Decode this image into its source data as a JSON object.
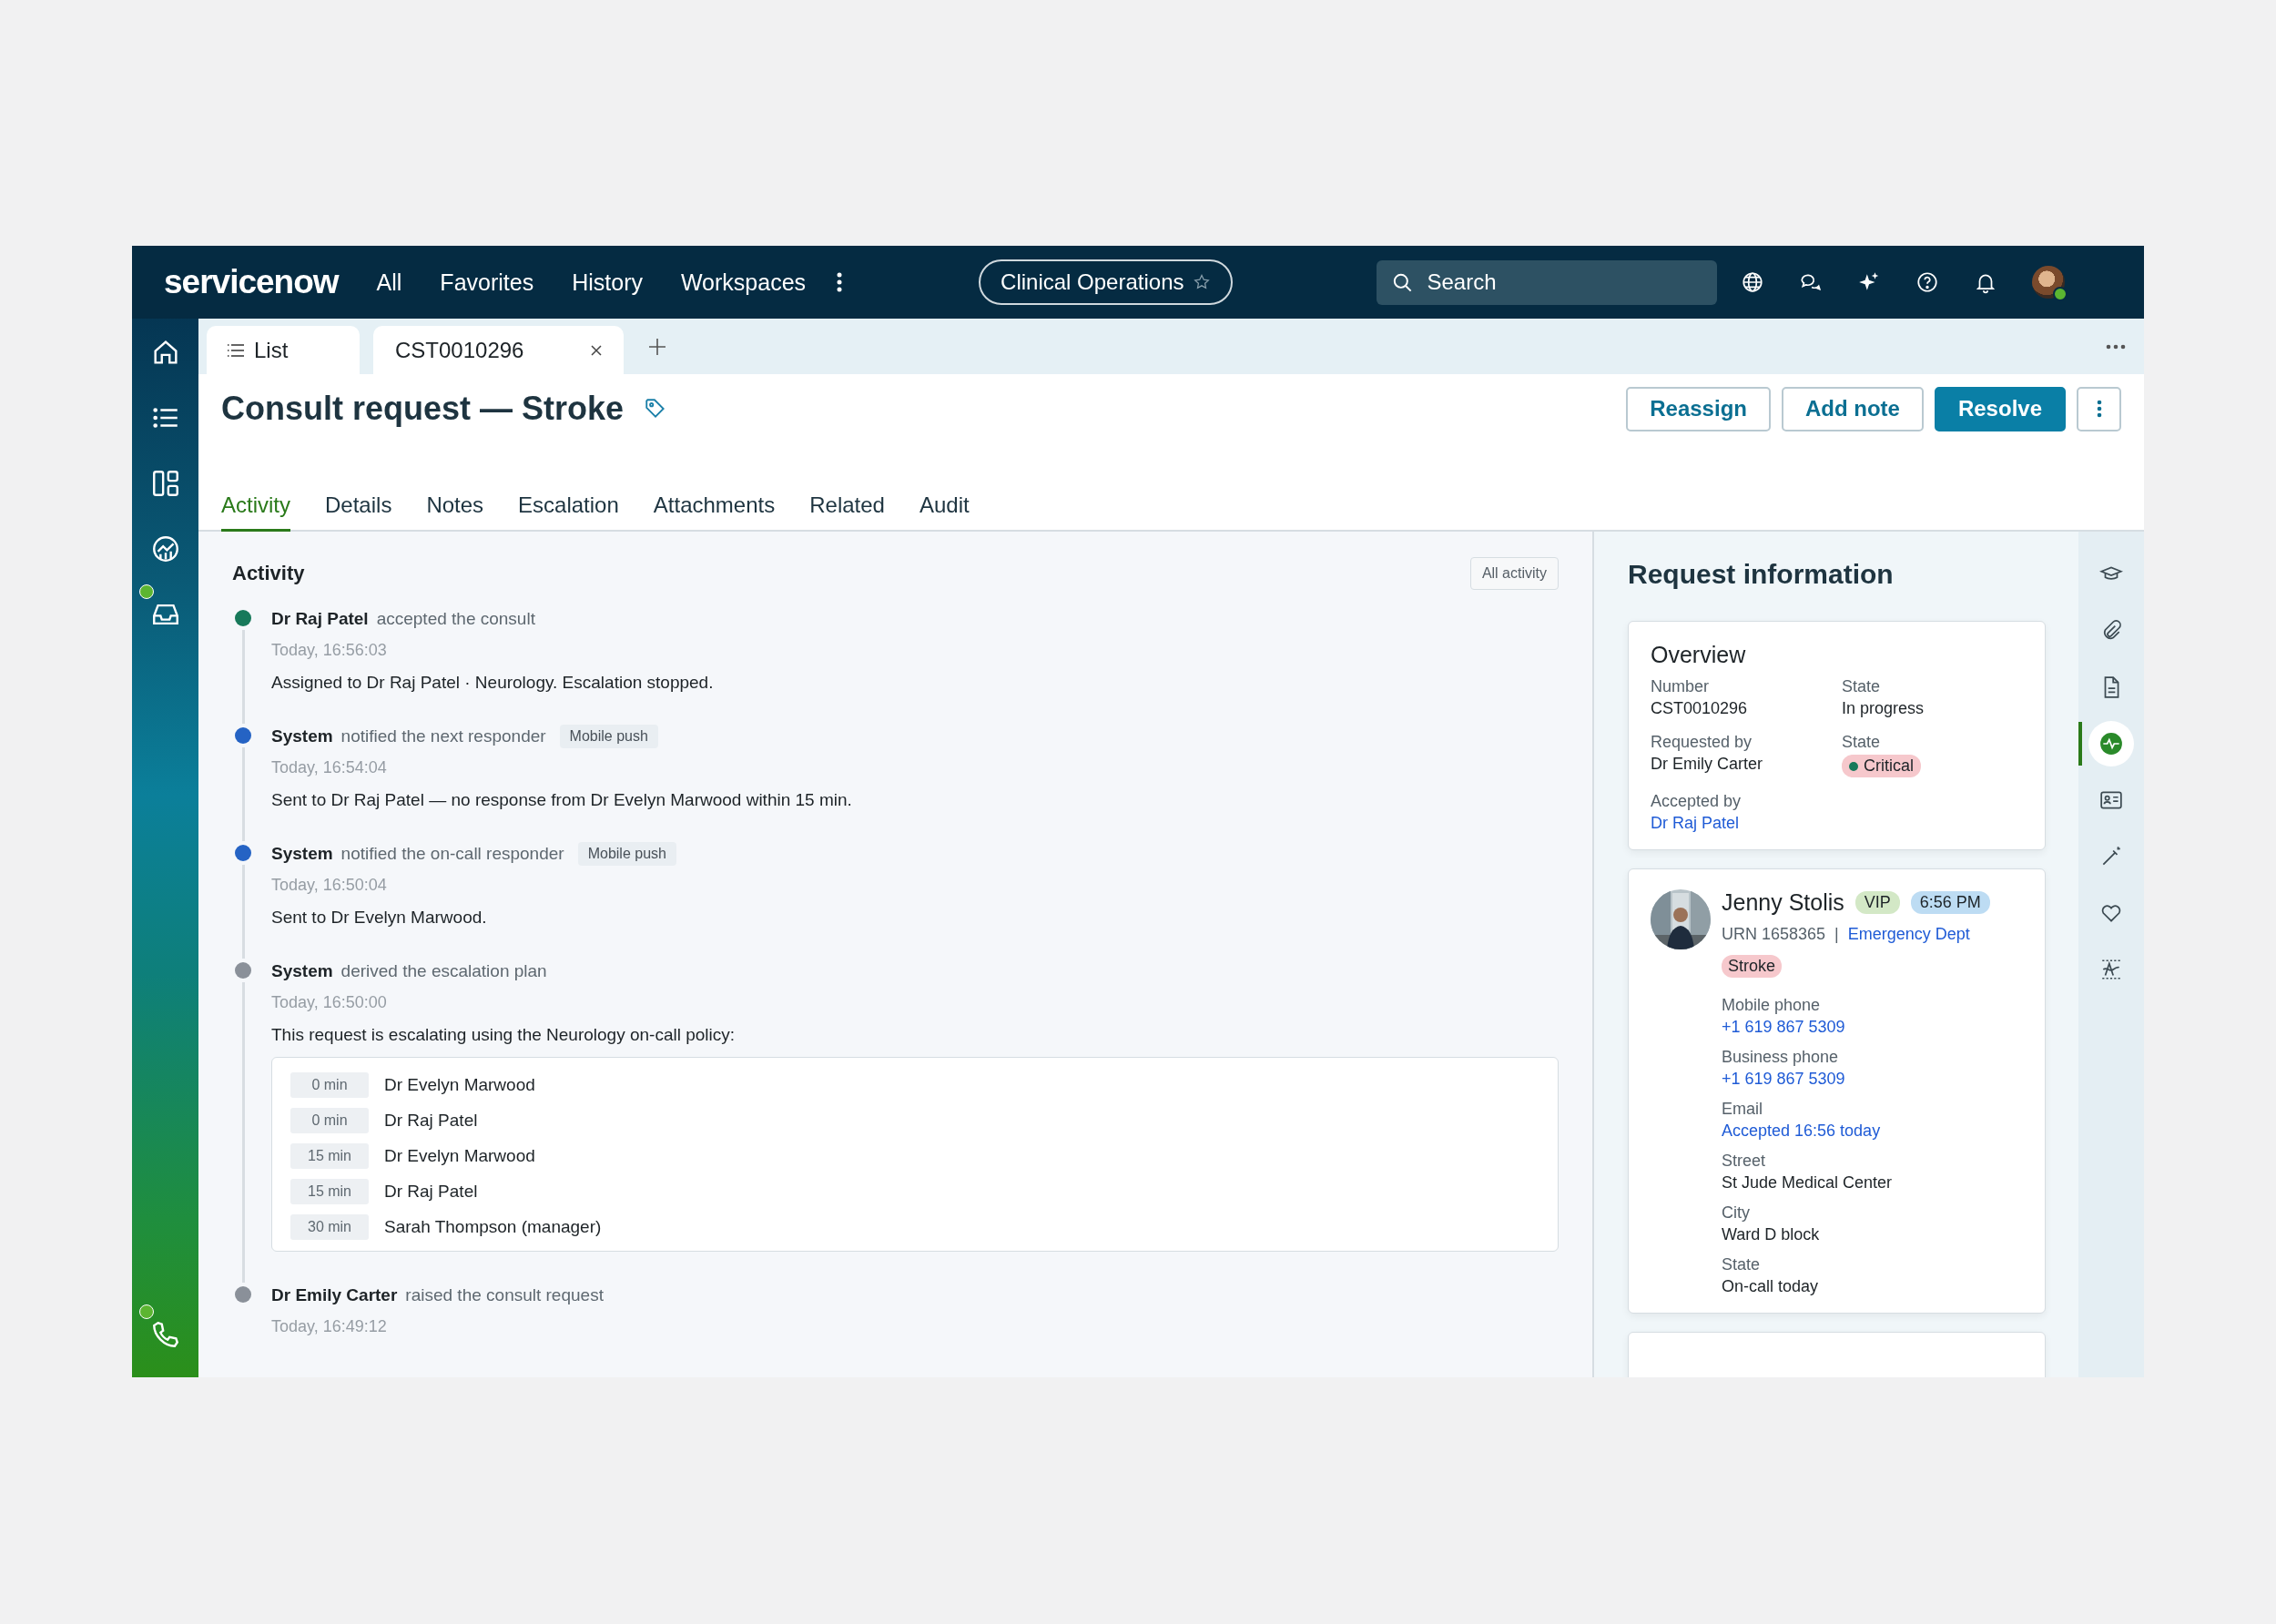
{
  "top_bar": {
    "logo": "servicenow",
    "nav": [
      "All",
      "Favorites",
      "History",
      "Workspaces"
    ],
    "workspace": "Clinical Operations",
    "search": {
      "placeholder": "Search"
    }
  },
  "rail": [
    {
      "badge": false
    },
    {
      "badge": false
    },
    {
      "badge": false
    },
    {
      "badge": false
    },
    {
      "badge": true
    },
    {
      "badge": true
    }
  ],
  "tab_bar": {
    "tabs": [
      {
        "label": "List",
        "kind": "list"
      },
      {
        "label": "CST0010296",
        "kind": "record"
      }
    ]
  },
  "title": "Consult request — Stroke",
  "actions": [
    {
      "label": "Reassign",
      "kind": "secondary"
    },
    {
      "label": "Add note",
      "kind": "secondary"
    },
    {
      "label": "Resolve",
      "kind": "primary"
    }
  ],
  "section_tabs": [
    {
      "label": "Activity",
      "selected": true
    },
    {
      "label": "Details",
      "selected": false
    },
    {
      "label": "Notes",
      "selected": false
    },
    {
      "label": "Escalation",
      "selected": false
    },
    {
      "label": "Attachments",
      "selected": false
    },
    {
      "label": "Related",
      "selected": false
    },
    {
      "label": "Audit",
      "selected": false
    }
  ],
  "activity": {
    "heading": "Activity",
    "filter": "All activity",
    "entries": [
      {
        "actor": "Dr Raj Patel",
        "action": "accepted the consult",
        "time": "Today, 16:56:03",
        "body": "Assigned to Dr Raj Patel · Neurology. Escalation stopped.",
        "color": "#17795a"
      },
      {
        "actor": "System",
        "action": "notified the next responder",
        "channel": "Mobile push",
        "time": "Today, 16:54:04",
        "body": "Sent to Dr Raj Patel — no response from Dr Evelyn Marwood within 15 min.",
        "color": "#2563c4"
      },
      {
        "actor": "System",
        "action": "notified the on-call responder",
        "channel": "Mobile push",
        "time": "Today, 16:50:04",
        "body": "Sent to Dr Evelyn Marwood.",
        "color": "#2563c4"
      },
      {
        "actor": "System",
        "action": "derived the escalation plan",
        "time": "Today, 16:50:00",
        "body": "This request is escalating using the Neurology on-call policy:",
        "color": "#8a9099",
        "policy": [
          {
            "delay": "0 min",
            "name": "Dr Evelyn Marwood"
          },
          {
            "delay": "0 min",
            "name": "Dr Raj Patel"
          },
          {
            "delay": "15 min",
            "name": "Dr Evelyn Marwood"
          },
          {
            "delay": "15 min",
            "name": "Dr Raj Patel"
          },
          {
            "delay": "30 min",
            "name": "Sarah Thompson (manager)"
          }
        ]
      },
      {
        "actor": "Dr Emily Carter",
        "action": "raised the consult request",
        "time": "Today, 16:49:12",
        "color": "#8a9099"
      }
    ]
  },
  "request_info": {
    "heading": "Request information",
    "overview": {
      "title": "Overview",
      "fields": [
        {
          "label": "Number",
          "value": "CST0010296",
          "kind": "text"
        },
        {
          "label": "State",
          "value": "In progress",
          "kind": "text"
        },
        {
          "label": "Requested by",
          "value": "Dr Emily Carter",
          "kind": "text"
        },
        {
          "label": "State",
          "value": "Critical",
          "kind": "badge"
        },
        {
          "label": "Accepted by",
          "value": "Dr Raj Patel",
          "kind": "link"
        }
      ]
    },
    "patient": {
      "name": "Jenny Stolis",
      "badges": [
        {
          "label": "VIP",
          "color": "#d3e8c6"
        },
        {
          "label": "6:56 PM",
          "color": "#bddcf3"
        }
      ],
      "urn": "URN 1658365",
      "separator": "|",
      "department": "Emergency Dept",
      "tag": "Stroke",
      "fields": [
        {
          "label": "Mobile phone",
          "value": "+1 619 867 5309",
          "kind": "link"
        },
        {
          "label": "Business phone",
          "value": "+1 619 867 5309",
          "kind": "link"
        },
        {
          "label": "Email",
          "value": "Accepted 16:56 today",
          "kind": "link"
        },
        {
          "label": "Street",
          "value": "St Jude Medical Center",
          "kind": "text"
        },
        {
          "label": "City",
          "value": "Ward D block",
          "kind": "text"
        },
        {
          "label": "State",
          "value": "On-call today",
          "kind": "text"
        }
      ]
    }
  },
  "side_rail": [
    {
      "selected": false
    },
    {
      "selected": false
    },
    {
      "selected": false
    },
    {
      "selected": true
    },
    {
      "selected": false
    },
    {
      "selected": false
    },
    {
      "selected": false
    },
    {
      "selected": false
    }
  ]
}
